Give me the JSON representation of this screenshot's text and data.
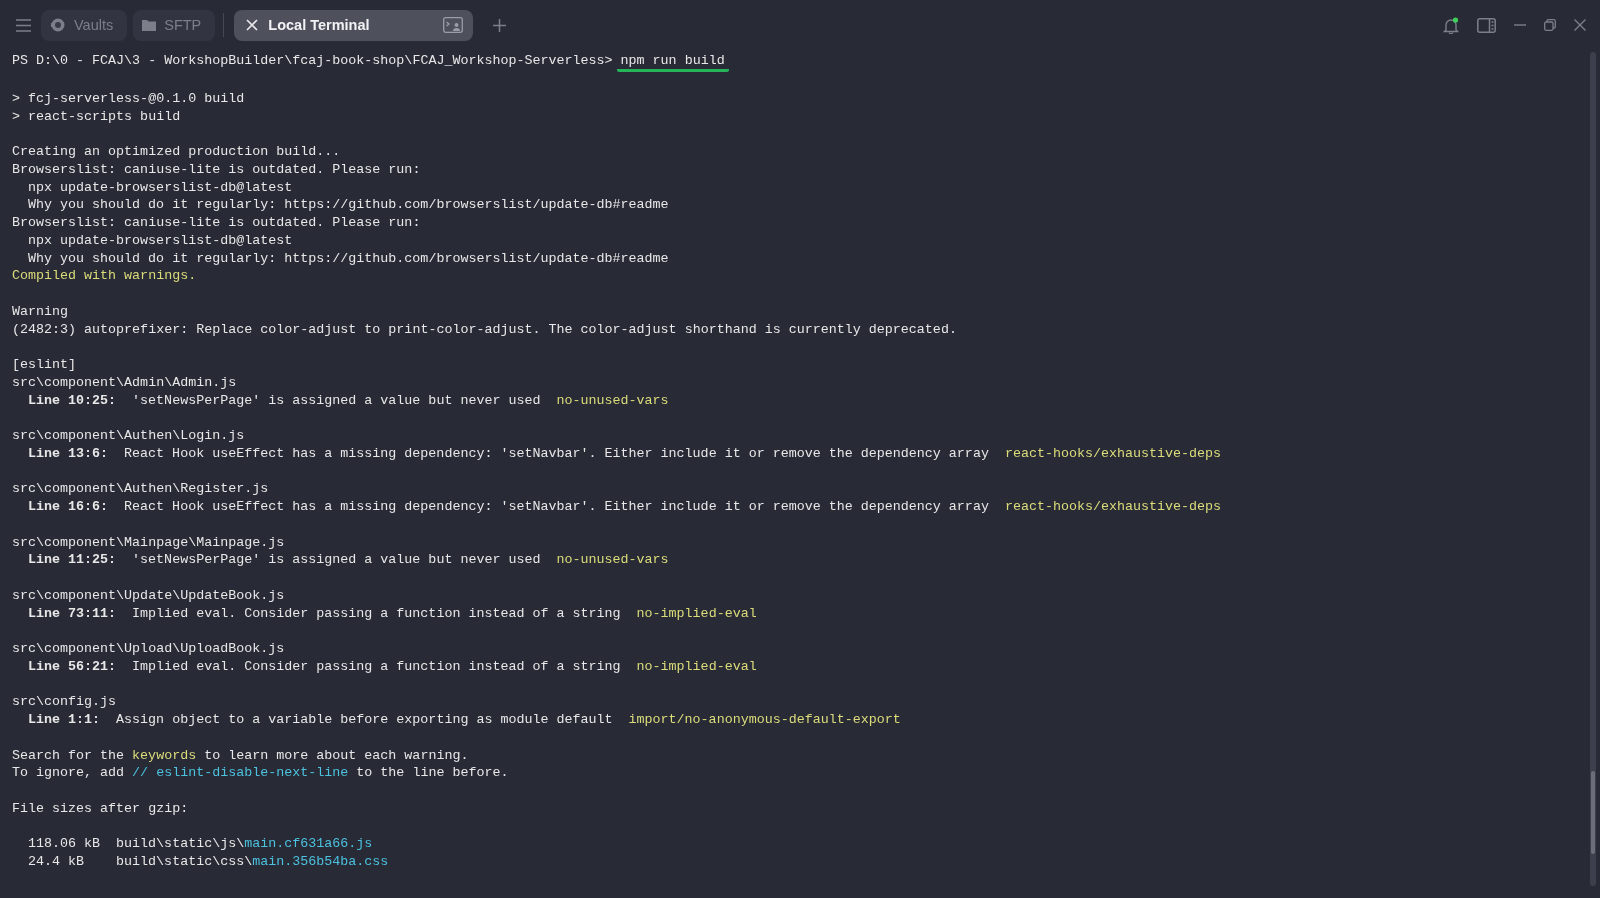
{
  "tabs": [
    {
      "label": "Vaults",
      "kind": "vaults",
      "selected": false
    },
    {
      "label": "SFTP",
      "kind": "sftp",
      "selected": false
    },
    {
      "label": "Local Terminal",
      "kind": "terminal",
      "selected": true
    }
  ],
  "notifications": {
    "unread": true
  },
  "terminal": {
    "lines": [
      {
        "kind": "prompt",
        "prompt": "PS D:\\0 - FCAJ\\3 - WorkshopBuilder\\fcaj-book-shop\\FCAJ_Workshop-Serverless>",
        "command": "npm run build"
      },
      {
        "kind": "blank"
      },
      {
        "kind": "text",
        "text": "> fcj-serverless-@0.1.0 build"
      },
      {
        "kind": "text",
        "text": "> react-scripts build"
      },
      {
        "kind": "blank"
      },
      {
        "kind": "text",
        "text": "Creating an optimized production build..."
      },
      {
        "kind": "text",
        "text": "Browserslist: caniuse-lite is outdated. Please run:"
      },
      {
        "kind": "indented",
        "text": "npx update-browserslist-db@latest"
      },
      {
        "kind": "indented",
        "text": "Why you should do it regularly: https://github.com/browserslist/update-db#readme"
      },
      {
        "kind": "text",
        "text": "Browserslist: caniuse-lite is outdated. Please run:"
      },
      {
        "kind": "indented",
        "text": "npx update-browserslist-db@latest"
      },
      {
        "kind": "indented",
        "text": "Why you should do it regularly: https://github.com/browserslist/update-db#readme"
      },
      {
        "kind": "notice",
        "text": "Compiled with warnings."
      },
      {
        "kind": "blank"
      },
      {
        "kind": "text",
        "text": "Warning"
      },
      {
        "kind": "text",
        "text": "(2482:3) autoprefixer: Replace color-adjust to print-color-adjust. The color-adjust shorthand is currently deprecated."
      },
      {
        "kind": "blank"
      },
      {
        "kind": "text",
        "text": "[eslint]"
      },
      {
        "kind": "text",
        "text": "src\\component\\Admin\\Admin.js"
      },
      {
        "kind": "lint",
        "location": "Line 10:25:",
        "message": "'setNewsPerPage' is assigned a value but never used",
        "rule": "no-unused-vars"
      },
      {
        "kind": "blank"
      },
      {
        "kind": "text",
        "text": "src\\component\\Authen\\Login.js"
      },
      {
        "kind": "lint",
        "location": "Line 13:6:",
        "message": "React Hook useEffect has a missing dependency: 'setNavbar'. Either include it or remove the dependency array",
        "rule": "react-hooks/exhaustive-deps"
      },
      {
        "kind": "blank"
      },
      {
        "kind": "text",
        "text": "src\\component\\Authen\\Register.js"
      },
      {
        "kind": "lint",
        "location": "Line 16:6:",
        "message": "React Hook useEffect has a missing dependency: 'setNavbar'. Either include it or remove the dependency array",
        "rule": "react-hooks/exhaustive-deps"
      },
      {
        "kind": "blank"
      },
      {
        "kind": "text",
        "text": "src\\component\\Mainpage\\Mainpage.js"
      },
      {
        "kind": "lint",
        "location": "Line 11:25:",
        "message": "'setNewsPerPage' is assigned a value but never used",
        "rule": "no-unused-vars"
      },
      {
        "kind": "blank"
      },
      {
        "kind": "text",
        "text": "src\\component\\Update\\UpdateBook.js"
      },
      {
        "kind": "lint",
        "location": "Line 73:11:",
        "message": "Implied eval. Consider passing a function instead of a string",
        "rule": "no-implied-eval"
      },
      {
        "kind": "blank"
      },
      {
        "kind": "text",
        "text": "src\\component\\Upload\\UploadBook.js"
      },
      {
        "kind": "lint",
        "location": "Line 56:21:",
        "message": "Implied eval. Consider passing a function instead of a string",
        "rule": "no-implied-eval"
      },
      {
        "kind": "blank"
      },
      {
        "kind": "text",
        "text": "src\\config.js"
      },
      {
        "kind": "lint",
        "location": "Line 1:1:",
        "message": "Assign object to a variable before exporting as module default",
        "rule": "import/no-anonymous-default-export"
      },
      {
        "kind": "blank"
      },
      {
        "kind": "keyword_hint",
        "before": "Search for the",
        "highlight": "keywords",
        "after": "to learn more about each warning."
      },
      {
        "kind": "code_hint",
        "before": "To ignore, add",
        "highlight": "// eslint-disable-next-line",
        "after": "to the line before."
      },
      {
        "kind": "blank"
      },
      {
        "kind": "text",
        "text": "File sizes after gzip:"
      },
      {
        "kind": "blank"
      },
      {
        "kind": "file",
        "size": "118.06 kB",
        "folder": "build\\static\\js\\",
        "name": "main.cf631a66.js"
      },
      {
        "kind": "file",
        "size": "24.4 kB",
        "folder": "build\\static\\css\\",
        "name": "main.356b54ba.css"
      }
    ]
  }
}
